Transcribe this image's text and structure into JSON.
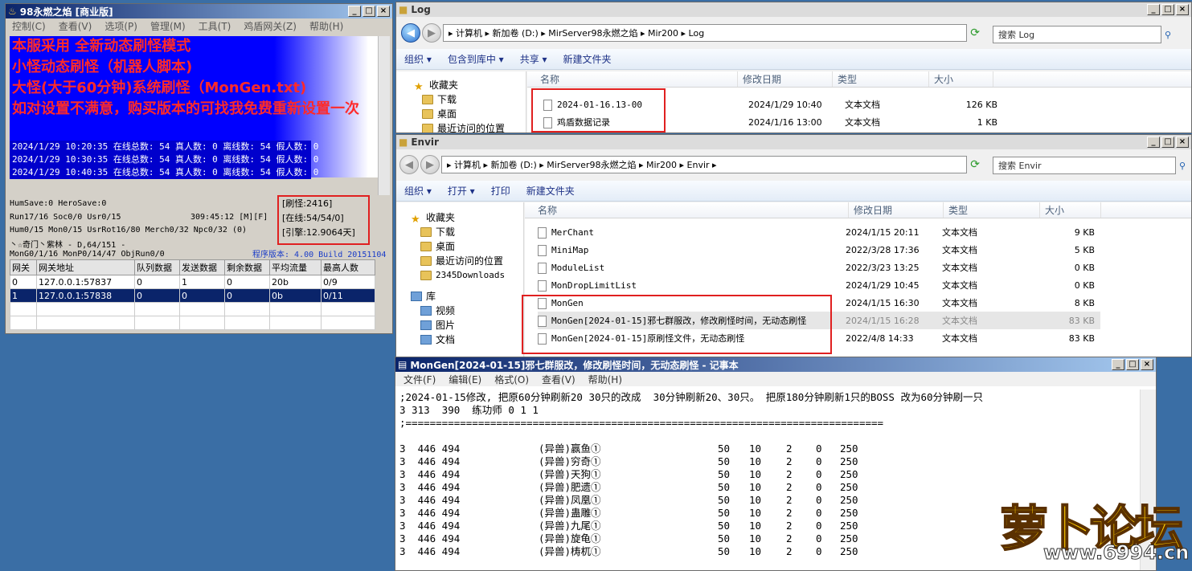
{
  "server": {
    "title": "98永燃之焰 [商业版]",
    "menu": [
      "控制(C)",
      "查看(V)",
      "选项(P)",
      "管理(M)",
      "工具(T)",
      "鸡盾网关(Z)",
      "帮助(H)"
    ],
    "notice": [
      "本服采用 全新动态刷怪模式",
      "小怪动态刷怪（机器人脚本)",
      "大怪(大于60分钟)系统刷怪（MonGen.txt)",
      "如对设置不满意，购买版本的可找我免费重新设置一次"
    ],
    "log": [
      "2024/1/29 10:20:35 在线总数: 54 真人数: 0 离线数: 54 假人数: 0",
      "2024/1/29 10:30:35 在线总数: 54 真人数: 0 离线数: 54 假人数: 0",
      "2024/1/29 10:40:35 在线总数: 54 真人数: 0 离线数: 54 假人数: 0"
    ],
    "stats": {
      "humsave": "HumSave:0 HeroSave:0",
      "run": "Run17/16 Soc0/0 Usr0/15",
      "uptime": "309:45:12 [M][F]",
      "hum": "Hum0/15 Mon0/15 UsrRot16/80 Merch0/32 Npc0/32 (0)",
      "guild": "丶☆奇门丶紫林 - D,64/151 -",
      "mongo": "MonG0/1/16 MonP0/14/47 ObjRun0/0",
      "version": "程序版本: 4.00 Build 20151104"
    },
    "redbox": [
      "[刷怪:2416]",
      "[在线:54/54/0]",
      "[引擎:12.9064天]"
    ],
    "gateway": {
      "headers": [
        "网关",
        "网关地址",
        "队列数据",
        "发送数据",
        "剩余数据",
        "平均流量",
        "最高人数"
      ],
      "rows": [
        [
          "0",
          "127.0.0.1:57837",
          "0",
          "1",
          "0",
          "20b",
          "0/9"
        ],
        [
          "1",
          "127.0.0.1:57838",
          "0",
          "0",
          "0",
          "0b",
          "0/11"
        ]
      ]
    }
  },
  "log_win": {
    "title": "Log",
    "path": "▸ 计算机 ▸ 新加卷 (D:) ▸ MirServer98永燃之焰 ▸ Mir200 ▸ Log",
    "search": "搜索 Log",
    "toolbar": [
      "组织 ▾",
      "包含到库中 ▾",
      "共享 ▾",
      "新建文件夹"
    ],
    "nav": [
      "收藏夹",
      "下载",
      "桌面",
      "最近访问的位置"
    ],
    "cols": [
      "名称",
      "修改日期",
      "类型",
      "大小"
    ],
    "files": [
      [
        "2024-01-16.13-00",
        "2024/1/29 10:40",
        "文本文档",
        "126 KB"
      ],
      [
        "鸡盾数据记录",
        "2024/1/16 13:00",
        "文本文档",
        "1 KB"
      ]
    ]
  },
  "envir_win": {
    "title": "Envir",
    "path": "▸ 计算机 ▸ 新加卷 (D:) ▸ MirServer98永燃之焰 ▸ Mir200 ▸ Envir ▸",
    "search": "搜索 Envir",
    "toolbar": [
      "组织 ▾",
      "打开 ▾",
      "打印",
      "新建文件夹"
    ],
    "nav": [
      "收藏夹",
      "下载",
      "桌面",
      "最近访问的位置",
      "2345Downloads",
      "库",
      "视频",
      "图片",
      "文档"
    ],
    "cols": [
      "名称",
      "修改日期",
      "类型",
      "大小"
    ],
    "files": [
      [
        "MerChant",
        "2024/1/15 20:11",
        "文本文档",
        "9 KB"
      ],
      [
        "MiniMap",
        "2022/3/28 17:36",
        "文本文档",
        "5 KB"
      ],
      [
        "ModuleList",
        "2022/3/23 13:25",
        "文本文档",
        "0 KB"
      ],
      [
        "MonDropLimitList",
        "2024/1/29 10:45",
        "文本文档",
        "0 KB"
      ],
      [
        "MonGen",
        "2024/1/15 16:30",
        "文本文档",
        "8 KB"
      ],
      [
        "MonGen[2024-01-15]邪七群服改，修改刷怪时间，无动态刷怪",
        "2024/1/15 16:28",
        "文本文档",
        "83 KB"
      ],
      [
        "MonGen[2024-01-15]原刷怪文件，无动态刷怪",
        "2022/4/8 14:33",
        "文本文档",
        "83 KB"
      ]
    ]
  },
  "notepad": {
    "title": "MonGen[2024-01-15]邪七群服改，修改刷怪时间，无动态刷怪 - 记事本",
    "menu": [
      "文件(F)",
      "编辑(E)",
      "格式(O)",
      "查看(V)",
      "帮助(H)"
    ],
    "header_lines": [
      ";2024-01-15修改, 把原60分钟刷新20 30只的改成  30分钟刷新20、30只。 把原180分钟刷新1只的BOSS 改为60分钟刷一只",
      "3 313  390  练功师 0 1 1",
      ";==============================================================================="
    ],
    "rows": [
      [
        "3  446 494",
        "(异兽)赢鱼①",
        "50",
        "10",
        "2",
        "0",
        "250"
      ],
      [
        "3  446 494",
        "(异兽)穷奇①",
        "50",
        "10",
        "2",
        "0",
        "250"
      ],
      [
        "3  446 494",
        "(异兽)天狗①",
        "50",
        "10",
        "2",
        "0",
        "250"
      ],
      [
        "3  446 494",
        "(异兽)肥遗①",
        "50",
        "10",
        "2",
        "0",
        "250"
      ],
      [
        "3  446 494",
        "(异兽)凤凰①",
        "50",
        "10",
        "2",
        "0",
        "250"
      ],
      [
        "3  446 494",
        "(异兽)蛊雕①",
        "50",
        "10",
        "2",
        "0",
        "250"
      ],
      [
        "3  446 494",
        "(异兽)九尾①",
        "50",
        "10",
        "2",
        "0",
        "250"
      ],
      [
        "3  446 494",
        "(异兽)旋龟①",
        "50",
        "10",
        "2",
        "0",
        "250"
      ],
      [
        "3  446 494",
        "(异兽)梼杌①",
        "50",
        "10",
        "2",
        "0",
        "250"
      ]
    ]
  },
  "watermark": {
    "brand": "萝卜论坛",
    "url": "www.6994.cn"
  },
  "colors": {
    "highlight": "#e02020",
    "selection": "#0a246a"
  }
}
